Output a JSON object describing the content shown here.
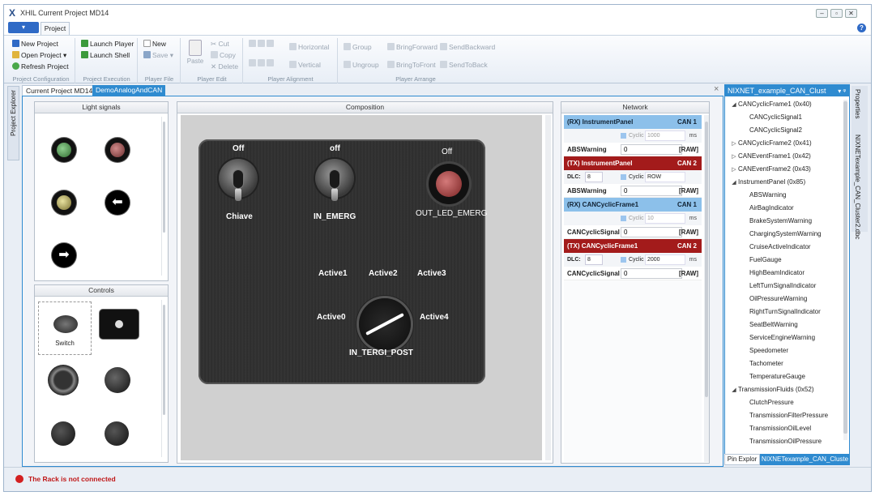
{
  "window": {
    "title": "XHIL Current Project MD14",
    "logo": "X",
    "min": "–",
    "max": "▫",
    "close": "✕"
  },
  "menu": {
    "file_button": "▾",
    "tab_project": "Project",
    "help": "?"
  },
  "ribbon": {
    "groups": [
      {
        "label": "Project Configuration",
        "items": [
          "New Project",
          "Open Project",
          "Refresh Project"
        ]
      },
      {
        "label": "Project Execution",
        "items": [
          "Launch Player",
          "Launch Shell"
        ]
      },
      {
        "label": "Player File",
        "items": [
          "New",
          "Save"
        ]
      },
      {
        "label": "Player Edit",
        "paste": "Paste",
        "items": [
          "Cut",
          "Copy",
          "Delete"
        ]
      },
      {
        "label": "Player Alignment",
        "items": [
          "Horizontal",
          "Vertical"
        ]
      },
      {
        "label": "Player Arrange",
        "items": [
          "Group",
          "Ungroup",
          "BringForward",
          "BringToFront",
          "SendBackward",
          "SendToBack"
        ]
      }
    ],
    "dropdown_arrow": "▾"
  },
  "tabs": {
    "doc1": "Current Project MD14",
    "doc2": "DemoAnalogAndCAN",
    "close": "×"
  },
  "left_rail": {
    "label": "Project Explorer"
  },
  "light_signals": {
    "title": "Light signals"
  },
  "controls": {
    "title": "Controls",
    "switch_label": "Switch"
  },
  "composition": {
    "title": "Composition",
    "chiave": {
      "state": "Off",
      "name": "Chiave"
    },
    "in_emerg": {
      "state": "off",
      "name": "IN_EMERG"
    },
    "out_led": {
      "state": "Off",
      "name": "OUT_LED_EMERG"
    },
    "rotary": {
      "name": "IN_TERGI_POST",
      "positions": [
        "Active0",
        "Active1",
        "Active2",
        "Active3",
        "Active4"
      ]
    }
  },
  "network": {
    "title": "Network",
    "rows": [
      {
        "kind": "rx",
        "label": "(RX) InstrumentPanel",
        "can": "CAN 1"
      },
      {
        "kind": "sub",
        "cyc": "Cyclic",
        "val": "1000",
        "ms": "ms"
      },
      {
        "kind": "sig",
        "label": "ABSWarning",
        "value": "0",
        "raw": "[RAW]"
      },
      {
        "kind": "tx",
        "label": "(TX) InstrumentPanel",
        "can": "CAN 2"
      },
      {
        "kind": "dlc",
        "dlc": "DLC:",
        "dlcv": "8",
        "cyc": "Cyclic",
        "val": "ROW"
      },
      {
        "kind": "sig",
        "label": "ABSWarning",
        "value": "0",
        "raw": "[RAW]"
      },
      {
        "kind": "rx",
        "label": "(RX) CANCyclicFrame1",
        "can": "CAN 1"
      },
      {
        "kind": "sub",
        "cyc": "Cyclic",
        "val": "10",
        "ms": "ms"
      },
      {
        "kind": "sig",
        "label": "CANCyclicSignal",
        "value": "0",
        "raw": "[RAW]"
      },
      {
        "kind": "tx",
        "label": "(TX) CANCyclicFrame1",
        "can": "CAN 2"
      },
      {
        "kind": "dlc",
        "dlc": "DLC:",
        "dlcv": "8",
        "cyc": "Cyclic",
        "val": "2000",
        "ms": "ms"
      },
      {
        "kind": "sig",
        "label": "CANCyclicSignal",
        "value": "0",
        "raw": "[RAW]"
      }
    ]
  },
  "right_panel": {
    "title": "NIXNET_example_CAN_Clust",
    "pin": "▾ ᵠ",
    "tree": [
      {
        "level": 0,
        "arrow": "◢",
        "label": "CANCyclicFrame1 (0x40)"
      },
      {
        "level": 1,
        "arrow": "",
        "label": "CANCyclicSignal1"
      },
      {
        "level": 1,
        "arrow": "",
        "label": "CANCyclicSignal2"
      },
      {
        "level": 0,
        "arrow": "▷",
        "label": "CANCyclicFrame2 (0x41)"
      },
      {
        "level": 0,
        "arrow": "▷",
        "label": "CANEventFrame1 (0x42)"
      },
      {
        "level": 0,
        "arrow": "▷",
        "label": "CANEventFrame2 (0x43)"
      },
      {
        "level": 0,
        "arrow": "◢",
        "label": "InstrumentPanel (0x85)"
      },
      {
        "level": 1,
        "arrow": "",
        "label": "ABSWarning"
      },
      {
        "level": 1,
        "arrow": "",
        "label": "AirBagIndicator"
      },
      {
        "level": 1,
        "arrow": "",
        "label": "BrakeSystemWarning"
      },
      {
        "level": 1,
        "arrow": "",
        "label": "ChargingSystemWarning"
      },
      {
        "level": 1,
        "arrow": "",
        "label": "CruiseActiveIndicator"
      },
      {
        "level": 1,
        "arrow": "",
        "label": "FuelGauge"
      },
      {
        "level": 1,
        "arrow": "",
        "label": "HighBeamIndicator"
      },
      {
        "level": 1,
        "arrow": "",
        "label": "LeftTurnSignalIndicator"
      },
      {
        "level": 1,
        "arrow": "",
        "label": "OilPressureWarning"
      },
      {
        "level": 1,
        "arrow": "",
        "label": "RightTurnSignalIndicator"
      },
      {
        "level": 1,
        "arrow": "",
        "label": "SeatBeltWarning"
      },
      {
        "level": 1,
        "arrow": "",
        "label": "ServiceEngineWarning"
      },
      {
        "level": 1,
        "arrow": "",
        "label": "Speedometer"
      },
      {
        "level": 1,
        "arrow": "",
        "label": "Tachometer"
      },
      {
        "level": 1,
        "arrow": "",
        "label": "TemperatureGauge"
      },
      {
        "level": 0,
        "arrow": "◢",
        "label": "TransmissionFluids (0x52)"
      },
      {
        "level": 1,
        "arrow": "",
        "label": "ClutchPressure"
      },
      {
        "level": 1,
        "arrow": "",
        "label": "TransmissionFilterPressure"
      },
      {
        "level": 1,
        "arrow": "",
        "label": "TransmissionOilLevel"
      },
      {
        "level": 1,
        "arrow": "",
        "label": "TransmissionOilPressure"
      }
    ],
    "tab1": "Pin Explor",
    "tab2": "NIXNETexample_CAN_Cluste"
  },
  "right_rail": {
    "tabs": [
      "Properties",
      "NIXNETexample_CAN_Cluster2.dbc"
    ]
  },
  "status": {
    "text": "The Rack is not connected"
  },
  "colors": {
    "accent": "#2f8bd0",
    "rx": "#8cc0ea",
    "tx": "#a31b1b",
    "error": "#c01818"
  }
}
